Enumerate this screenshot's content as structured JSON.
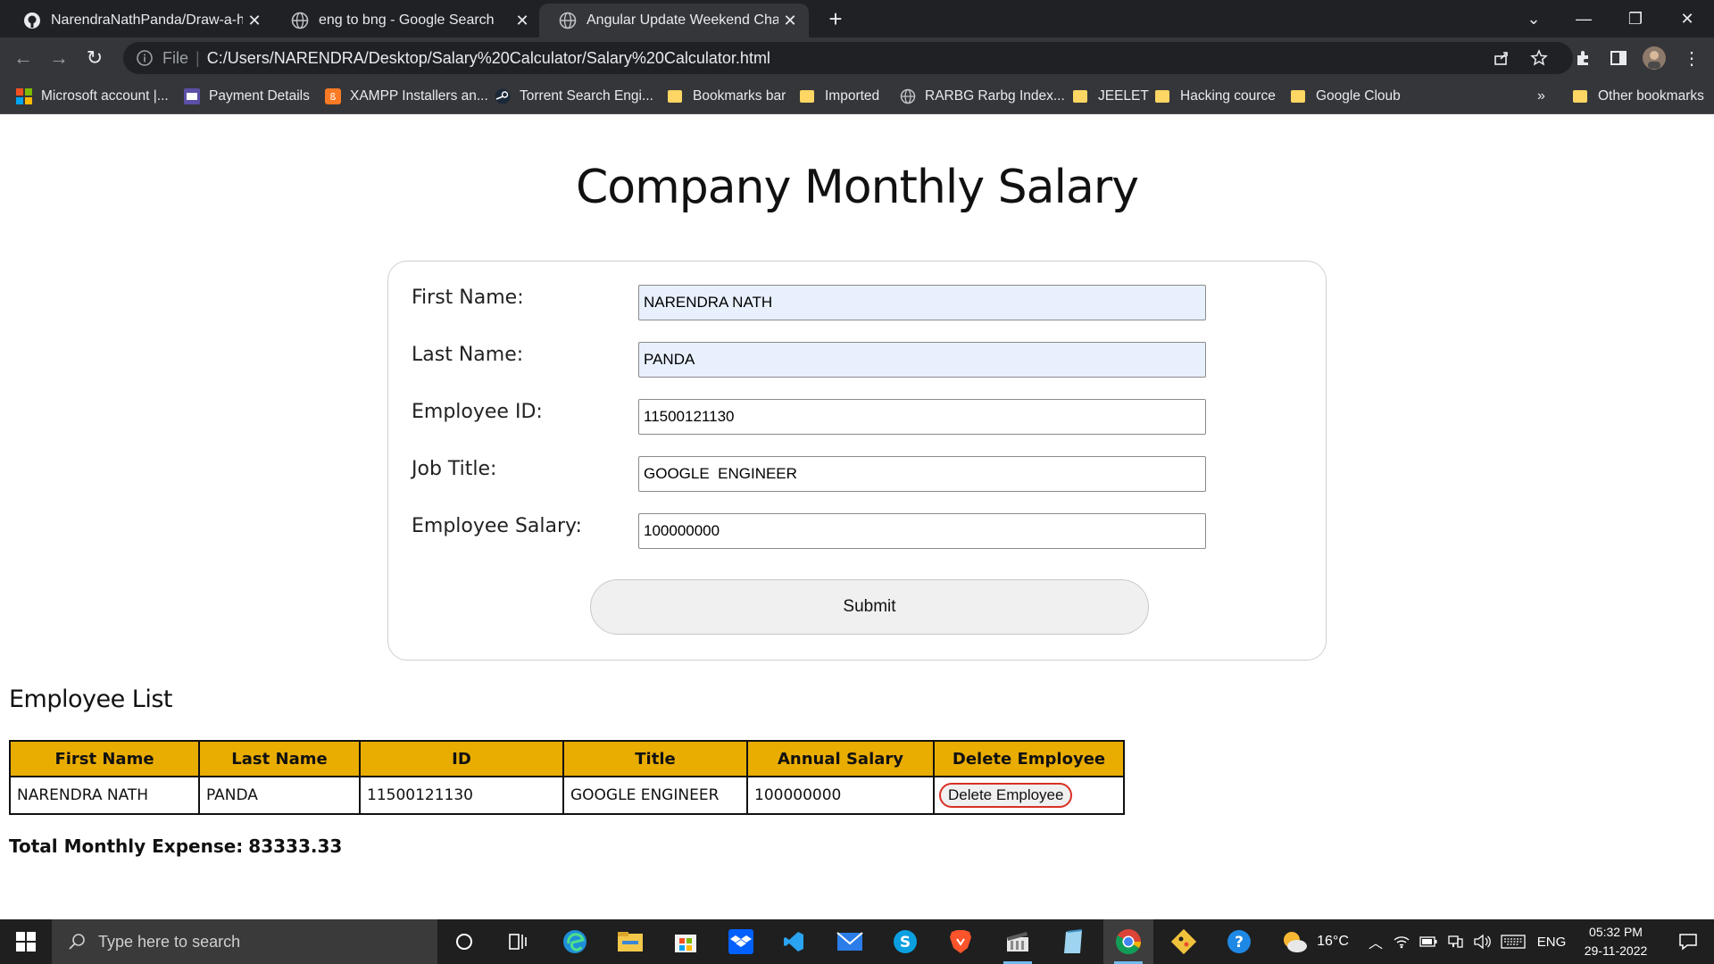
{
  "browser": {
    "tabs": [
      {
        "title": "NarendraNathPanda/Draw-a-hea",
        "icon": "github-icon",
        "active": false
      },
      {
        "title": "eng to bng - Google Search",
        "icon": "globe-icon",
        "active": false
      },
      {
        "title": "Angular Update Weekend Challen",
        "icon": "globe-icon",
        "active": true
      }
    ],
    "new_tab": "+",
    "address": {
      "scheme_label": "File",
      "separator": "|",
      "url": "C:/Users/NARENDRA/Desktop/Salary%20Calculator/Salary%20Calculator.html"
    },
    "bookmarks": [
      {
        "label": "Microsoft account |...",
        "icon": "microsoft-icon"
      },
      {
        "label": "Payment Details",
        "icon": "payment-icon"
      },
      {
        "label": "XAMPP Installers an...",
        "icon": "xampp-icon"
      },
      {
        "label": "Torrent Search Engi...",
        "icon": "steam-icon"
      },
      {
        "label": "Bookmarks bar",
        "icon": "folder-icon"
      },
      {
        "label": "Imported",
        "icon": "folder-icon"
      },
      {
        "label": "RARBG Rarbg Index...",
        "icon": "globe-icon"
      },
      {
        "label": "JEELET",
        "icon": "folder-icon"
      },
      {
        "label": "Hacking cource",
        "icon": "folder-icon"
      },
      {
        "label": "Google Cloub",
        "icon": "folder-icon"
      }
    ],
    "bookmarks_overflow": "»",
    "other_bookmarks": "Other bookmarks"
  },
  "page": {
    "title": "Company Monthly Salary",
    "form": {
      "first_name_label": "First Name:",
      "first_name_value": "NARENDRA NATH",
      "last_name_label": "Last Name:",
      "last_name_value": "PANDA",
      "employee_id_label": "Employee ID:",
      "employee_id_value": "11500121130",
      "job_title_label": "Job Title:",
      "job_title_value": "GOOGLE  ENGINEER",
      "salary_label": "Employee Salary:",
      "salary_value": "100000000",
      "submit_label": "Submit"
    },
    "employee_list": {
      "heading": "Employee List",
      "columns": [
        "First Name",
        "Last Name",
        "ID",
        "Title",
        "Annual Salary",
        "Delete Employee"
      ],
      "rows": [
        {
          "first_name": "NARENDRA NATH",
          "last_name": "PANDA",
          "id": "11500121130",
          "title": "GOOGLE ENGINEER",
          "annual_salary": "100000000",
          "delete_label": "Delete Employee"
        }
      ]
    },
    "total_label": "Total Monthly Expense:",
    "total_value": "83333.33"
  },
  "taskbar": {
    "search_placeholder": "Type here to search",
    "weather": "16°C",
    "language": "ENG",
    "time": "05:32 PM",
    "date": "29-11-2022"
  },
  "colors": {
    "table_header": "#e9ac00",
    "delete_border": "#d93025",
    "autofill_bg": "#e8f0fe",
    "chrome_dark": "#202124",
    "chrome_toolbar": "#35363a"
  }
}
